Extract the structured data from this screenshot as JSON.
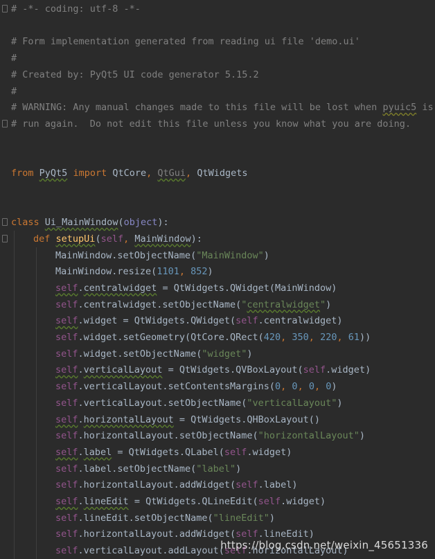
{
  "editor": {
    "language": "python",
    "colors": {
      "background": "#2b2b2b",
      "comment": "#808080",
      "keyword": "#cc7832",
      "string": "#6a8759",
      "number": "#6897bb",
      "self": "#94558d",
      "function": "#ffc66d",
      "text": "#a9b7c6"
    },
    "lines": [
      {
        "fold": true,
        "indent": 0,
        "tokens": [
          [
            "# -*- coding: utf-8 -*-",
            "comment"
          ]
        ]
      },
      {
        "indent": 0,
        "tokens": []
      },
      {
        "indent": 0,
        "tokens": [
          [
            "# Form implementation generated from reading ui file 'demo.ui'",
            "comment"
          ]
        ]
      },
      {
        "indent": 0,
        "tokens": [
          [
            "#",
            "comment"
          ]
        ]
      },
      {
        "indent": 0,
        "tokens": [
          [
            "# Created by: PyQt5 UI code generator 5.15.2",
            "comment"
          ]
        ]
      },
      {
        "indent": 0,
        "tokens": [
          [
            "#",
            "comment"
          ]
        ]
      },
      {
        "indent": 0,
        "tokens": [
          [
            "# WARNING: Any manual changes made to this file will be lost when ",
            "comment"
          ],
          [
            "pyuic5",
            "comment-warn"
          ],
          [
            " is",
            "comment"
          ]
        ]
      },
      {
        "fold": true,
        "indent": 0,
        "tokens": [
          [
            "# run again.  Do not edit this file unless you know what you are doing.",
            "comment"
          ]
        ]
      },
      {
        "indent": 0,
        "tokens": []
      },
      {
        "indent": 0,
        "tokens": []
      },
      {
        "indent": 0,
        "tokens": [
          [
            "from",
            "kw"
          ],
          [
            " ",
            "plain"
          ],
          [
            "PyQt5",
            "plain-typo"
          ],
          [
            " ",
            "plain"
          ],
          [
            "import",
            "kw"
          ],
          [
            " QtCore",
            "plain"
          ],
          [
            ",",
            "kw"
          ],
          [
            " ",
            "plain"
          ],
          [
            "QtGui",
            "comment-typo"
          ],
          [
            ",",
            "kw"
          ],
          [
            " QtWidgets",
            "plain"
          ]
        ]
      },
      {
        "indent": 0,
        "tokens": []
      },
      {
        "indent": 0,
        "tokens": []
      },
      {
        "fold": true,
        "indent": 0,
        "tokens": [
          [
            "class",
            "kw"
          ],
          [
            " ",
            "plain"
          ],
          [
            "Ui_MainWindow",
            "plain-typo"
          ],
          [
            "(",
            "plain"
          ],
          [
            "object",
            "builtin"
          ],
          [
            "):",
            "plain"
          ]
        ]
      },
      {
        "fold": true,
        "indent": 1,
        "tokens": [
          [
            "def",
            "kw"
          ],
          [
            " ",
            "plain"
          ],
          [
            "setupUi",
            "fn-typo"
          ],
          [
            "(",
            "plain"
          ],
          [
            "self",
            "self"
          ],
          [
            ",",
            "kw"
          ],
          [
            " ",
            "plain"
          ],
          [
            "MainWindow",
            "plain-typo"
          ],
          [
            "):",
            "plain"
          ]
        ]
      },
      {
        "indent": 2,
        "tokens": [
          [
            "MainWindow.setObjectName(",
            "plain"
          ],
          [
            "\"MainWindow\"",
            "str"
          ],
          [
            ")",
            "plain"
          ]
        ]
      },
      {
        "indent": 2,
        "tokens": [
          [
            "MainWindow.resize(",
            "plain"
          ],
          [
            "1101",
            "num"
          ],
          [
            ",",
            "kw"
          ],
          [
            " ",
            "plain"
          ],
          [
            "852",
            "num"
          ],
          [
            ")",
            "plain"
          ]
        ]
      },
      {
        "indent": 2,
        "tokens": [
          [
            "self",
            "self-typo"
          ],
          [
            ".",
            "plain"
          ],
          [
            "centralwidget",
            "plain-typo"
          ],
          [
            " = QtWidgets.QWidget(MainWindow)",
            "plain"
          ]
        ]
      },
      {
        "indent": 2,
        "tokens": [
          [
            "self",
            "self"
          ],
          [
            ".centralwidget.setObjectName(",
            "plain"
          ],
          [
            "\"",
            "str"
          ],
          [
            "centralwidget",
            "str-typo"
          ],
          [
            "\"",
            "str"
          ],
          [
            ")",
            "plain"
          ]
        ]
      },
      {
        "indent": 2,
        "tokens": [
          [
            "self",
            "self-typo"
          ],
          [
            ".widget = QtWidgets.QWidget(",
            "plain"
          ],
          [
            "self",
            "self"
          ],
          [
            ".centralwidget)",
            "plain"
          ]
        ]
      },
      {
        "indent": 2,
        "tokens": [
          [
            "self",
            "self"
          ],
          [
            ".widget.setGeometry(QtCore.QRect(",
            "plain"
          ],
          [
            "420",
            "num"
          ],
          [
            ",",
            "kw"
          ],
          [
            " ",
            "plain"
          ],
          [
            "350",
            "num"
          ],
          [
            ",",
            "kw"
          ],
          [
            " ",
            "plain"
          ],
          [
            "220",
            "num"
          ],
          [
            ",",
            "kw"
          ],
          [
            " ",
            "plain"
          ],
          [
            "61",
            "num"
          ],
          [
            "))",
            "plain"
          ]
        ]
      },
      {
        "indent": 2,
        "tokens": [
          [
            "self",
            "self"
          ],
          [
            ".widget.setObjectName(",
            "plain"
          ],
          [
            "\"widget\"",
            "str"
          ],
          [
            ")",
            "plain"
          ]
        ]
      },
      {
        "indent": 2,
        "tokens": [
          [
            "self",
            "self-typo"
          ],
          [
            ".",
            "plain"
          ],
          [
            "verticalLayout",
            "plain-typo"
          ],
          [
            " = QtWidgets.QVBoxLayout(",
            "plain"
          ],
          [
            "self",
            "self"
          ],
          [
            ".widget)",
            "plain"
          ]
        ]
      },
      {
        "indent": 2,
        "tokens": [
          [
            "self",
            "self"
          ],
          [
            ".verticalLayout.setContentsMargins(",
            "plain"
          ],
          [
            "0",
            "num"
          ],
          [
            ",",
            "kw"
          ],
          [
            " ",
            "plain"
          ],
          [
            "0",
            "num"
          ],
          [
            ",",
            "kw"
          ],
          [
            " ",
            "plain"
          ],
          [
            "0",
            "num"
          ],
          [
            ",",
            "kw"
          ],
          [
            " ",
            "plain"
          ],
          [
            "0",
            "num"
          ],
          [
            ")",
            "plain"
          ]
        ]
      },
      {
        "indent": 2,
        "tokens": [
          [
            "self",
            "self"
          ],
          [
            ".verticalLayout.setObjectName(",
            "plain"
          ],
          [
            "\"verticalLayout\"",
            "str"
          ],
          [
            ")",
            "plain"
          ]
        ]
      },
      {
        "indent": 2,
        "tokens": [
          [
            "self",
            "self-typo"
          ],
          [
            ".",
            "plain"
          ],
          [
            "horizontalLayout",
            "plain-typo"
          ],
          [
            " = QtWidgets.QHBoxLayout()",
            "plain"
          ]
        ]
      },
      {
        "indent": 2,
        "tokens": [
          [
            "self",
            "self"
          ],
          [
            ".horizontalLayout.setObjectName(",
            "plain"
          ],
          [
            "\"horizontalLayout\"",
            "str"
          ],
          [
            ")",
            "plain"
          ]
        ]
      },
      {
        "indent": 2,
        "tokens": [
          [
            "self",
            "self-typo"
          ],
          [
            ".",
            "plain"
          ],
          [
            "label",
            "plain-typo"
          ],
          [
            " = QtWidgets.QLabel(",
            "plain"
          ],
          [
            "self",
            "self"
          ],
          [
            ".widget)",
            "plain"
          ]
        ]
      },
      {
        "indent": 2,
        "tokens": [
          [
            "self",
            "self"
          ],
          [
            ".label.setObjectName(",
            "plain"
          ],
          [
            "\"label\"",
            "str"
          ],
          [
            ")",
            "plain"
          ]
        ]
      },
      {
        "indent": 2,
        "tokens": [
          [
            "self",
            "self"
          ],
          [
            ".horizontalLayout.addWidget(",
            "plain"
          ],
          [
            "self",
            "self"
          ],
          [
            ".label)",
            "plain"
          ]
        ]
      },
      {
        "indent": 2,
        "tokens": [
          [
            "self",
            "self-typo"
          ],
          [
            ".",
            "plain"
          ],
          [
            "lineEdit",
            "plain-typo"
          ],
          [
            " = QtWidgets.QLineEdit(",
            "plain"
          ],
          [
            "self",
            "self"
          ],
          [
            ".widget)",
            "plain"
          ]
        ]
      },
      {
        "indent": 2,
        "tokens": [
          [
            "self",
            "self"
          ],
          [
            ".lineEdit.setObjectName(",
            "plain"
          ],
          [
            "\"lineEdit\"",
            "str"
          ],
          [
            ")",
            "plain"
          ]
        ]
      },
      {
        "indent": 2,
        "tokens": [
          [
            "self",
            "self"
          ],
          [
            ".horizontalLayout.addWidget(",
            "plain"
          ],
          [
            "self",
            "self"
          ],
          [
            ".lineEdit)",
            "plain"
          ]
        ]
      },
      {
        "indent": 2,
        "tokens": [
          [
            "self",
            "self"
          ],
          [
            ".verticalLayout.addLayout(",
            "plain"
          ],
          [
            "self",
            "self"
          ],
          [
            ".horizontalLayout)",
            "plain"
          ]
        ]
      }
    ]
  },
  "watermark": "https://blog.csdn.net/weixin_45651336"
}
